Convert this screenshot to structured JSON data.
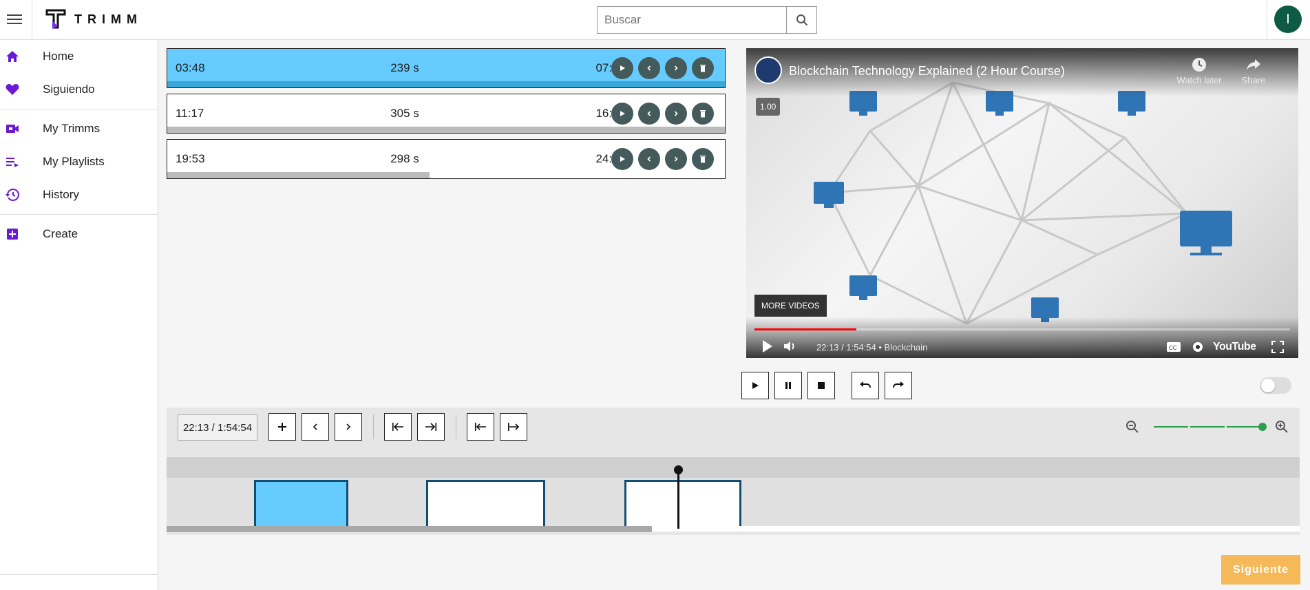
{
  "app": {
    "brand": "TRIMM"
  },
  "search": {
    "placeholder": "Buscar"
  },
  "user": {
    "avatar_letter": "I"
  },
  "sidebar": {
    "items": [
      {
        "label": "Home",
        "icon": "home-icon"
      },
      {
        "label": "Siguiendo",
        "icon": "heart-icon"
      },
      {
        "label": "My Trimms",
        "icon": "video-camera-icon"
      },
      {
        "label": "My Playlists",
        "icon": "playlist-icon"
      },
      {
        "label": "History",
        "icon": "history-icon"
      },
      {
        "label": "Create",
        "icon": "add-box-icon"
      }
    ]
  },
  "trimms": [
    {
      "start": "03:48",
      "duration": "239 s",
      "end": "07:47",
      "active": true,
      "progress": 1.0
    },
    {
      "start": "11:17",
      "duration": "305 s",
      "end": "16:22",
      "active": false,
      "progress": 1.0
    },
    {
      "start": "19:53",
      "duration": "298 s",
      "end": "24:51",
      "active": false,
      "progress": 0.47
    }
  ],
  "video": {
    "title": "Blockchain Technology Explained (2 Hour Course)",
    "watch_later": "Watch later",
    "share": "Share",
    "speed": "1.00",
    "more_videos": "MORE VIDEOS",
    "time": "22:13 / 1:54:54",
    "chapter": "• Blockchain",
    "youtube": "YouTube",
    "progress": 0.19
  },
  "timeline": {
    "time_display": "22:13 / 1:54:54",
    "zoom_level": 1.0
  },
  "footer": {
    "next_label": "Siguiente"
  },
  "colors": {
    "accent": "#66ccff",
    "dark_button": "#455a5a",
    "clip_border": "#124e73",
    "next": "#f5b95a",
    "avatar": "#0d5b45",
    "nav_icon": "#6a1bd1"
  }
}
